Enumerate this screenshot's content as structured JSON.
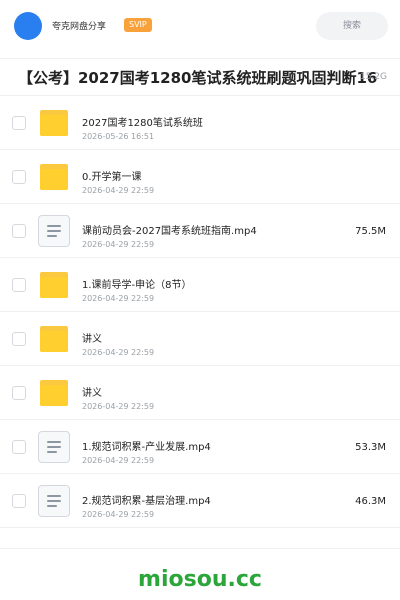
{
  "header": {
    "app_name": "夸克网盘分享",
    "badge": "SVIP",
    "search_placeholder": "搜索",
    "avatar_color": "#2a7ff0"
  },
  "share": {
    "title": "【公考】2027国考1280笔试系统班刷题巩固判断16",
    "total_size": "15.2G"
  },
  "files": [
    {
      "type": "folder",
      "icon": "folder-icon",
      "name": "2027国考1280笔试系统班",
      "date": "2026-05-26 16:51",
      "size": ""
    },
    {
      "type": "folder",
      "icon": "folder-icon",
      "name": "0.开学第一课",
      "date": "2026-04-29 22:59",
      "size": ""
    },
    {
      "type": "file",
      "icon": "document-icon",
      "name": "课前动员会-2027国考系统班指南.mp4",
      "date": "2026-04-29 22:59",
      "size": "75.5M"
    },
    {
      "type": "folder",
      "icon": "folder-icon",
      "name": "1.课前导学-申论（8节）",
      "date": "2026-04-29 22:59",
      "size": ""
    },
    {
      "type": "folder",
      "icon": "folder-icon",
      "name": "讲义",
      "date": "2026-04-29 22:59",
      "size": ""
    },
    {
      "type": "folder",
      "icon": "folder-icon",
      "name": "讲义",
      "date": "2026-04-29 22:59",
      "size": ""
    },
    {
      "type": "file",
      "icon": "document-icon",
      "name": "1.规范词积累-产业发展.mp4",
      "date": "2026-04-29 22:59",
      "size": "53.3M"
    },
    {
      "type": "file",
      "icon": "document-icon",
      "name": "2.规范词积累-基层治理.mp4",
      "date": "2026-04-29 22:59",
      "size": "46.3M"
    }
  ],
  "footer": {
    "watermark": "miosou.cc",
    "watermark_color": "#2ca53a"
  }
}
